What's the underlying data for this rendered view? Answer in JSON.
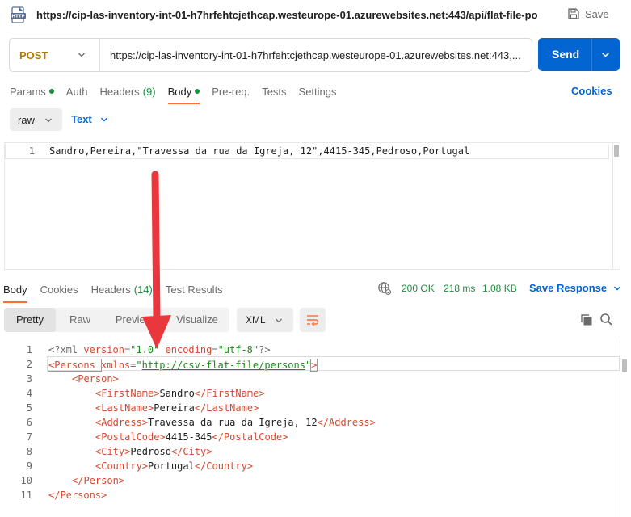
{
  "request": {
    "title": "https://cip-las-inventory-int-01-h7hrfehtcjethcap.westeurope-01.azurewebsites.net:443/api/flat-file-po...",
    "icon": "http-file-icon",
    "save_label": "Save",
    "method": "POST",
    "url": "https://cip-las-inventory-int-01-h7hrfehtcjethcap.westeurope-01.azurewebsites.net:443,...",
    "send_label": "Send"
  },
  "req_tabs": {
    "params": "Params",
    "auth": "Auth",
    "headers": "Headers",
    "headers_count": "(9)",
    "body": "Body",
    "prereq": "Pre-req.",
    "tests": "Tests",
    "settings": "Settings",
    "cookies": "Cookies"
  },
  "body_mode": {
    "raw": "raw",
    "text": "Text"
  },
  "request_body": {
    "lines": [
      {
        "n": "1",
        "text": "Sandro,Pereira,\"Travessa da rua da Igreja, 12\",4415-345,Pedroso,Portugal"
      }
    ]
  },
  "resp_tabs": {
    "body": "Body",
    "cookies": "Cookies",
    "headers": "Headers",
    "headers_count": "(14)",
    "test_results": "Test Results"
  },
  "status": {
    "code": "200 OK",
    "time": "218 ms",
    "size": "1.08 KB",
    "save_response": "Save Response"
  },
  "view_tabs": {
    "pretty": "Pretty",
    "raw": "Raw",
    "preview": "Preview",
    "visualize": "Visualize",
    "format": "XML"
  },
  "response_body": {
    "line_numbers": [
      "1",
      "2",
      "3",
      "4",
      "5",
      "6",
      "7",
      "8",
      "9",
      "10",
      "11"
    ],
    "l1": {
      "open": "<?xml ",
      "a1": "version",
      "eq1": "=",
      "v1": "\"1.0\"",
      "sp": " ",
      "a2": "encoding",
      "eq2": "=",
      "v2": "\"utf-8\"",
      "close": "?>"
    },
    "l2": {
      "open": "<Persons ",
      "attr": "xmlns",
      "eq": "=",
      "q1": "\"",
      "url": "http://csv-flat-file/persons",
      "q2": "\"",
      "close": ">"
    },
    "l3": "<Person>",
    "l4": {
      "o": "<FirstName>",
      "v": "Sandro",
      "c": "</FirstName>"
    },
    "l5": {
      "o": "<LastName>",
      "v": "Pereira",
      "c": "</LastName>"
    },
    "l6": {
      "o": "<Address>",
      "v": "Travessa da rua da Igreja, 12",
      "c": "</Address>"
    },
    "l7": {
      "o": "<PostalCode>",
      "v": "4415-345",
      "c": "</PostalCode>"
    },
    "l8": {
      "o": "<City>",
      "v": "Pedroso",
      "c": "</City>"
    },
    "l9": {
      "o": "<Country>",
      "v": "Portugal",
      "c": "</Country>"
    },
    "l10": "</Person>",
    "l11": "</Persons>"
  },
  "colors": {
    "accent_orange": "#ff6c37",
    "send_blue": "#0265d2",
    "status_green": "#1b8e3f",
    "method_color": "#ad7a03",
    "tag_color": "#d14b2e",
    "string_color": "#1a8a1a",
    "arrow_red": "#e8383d"
  }
}
